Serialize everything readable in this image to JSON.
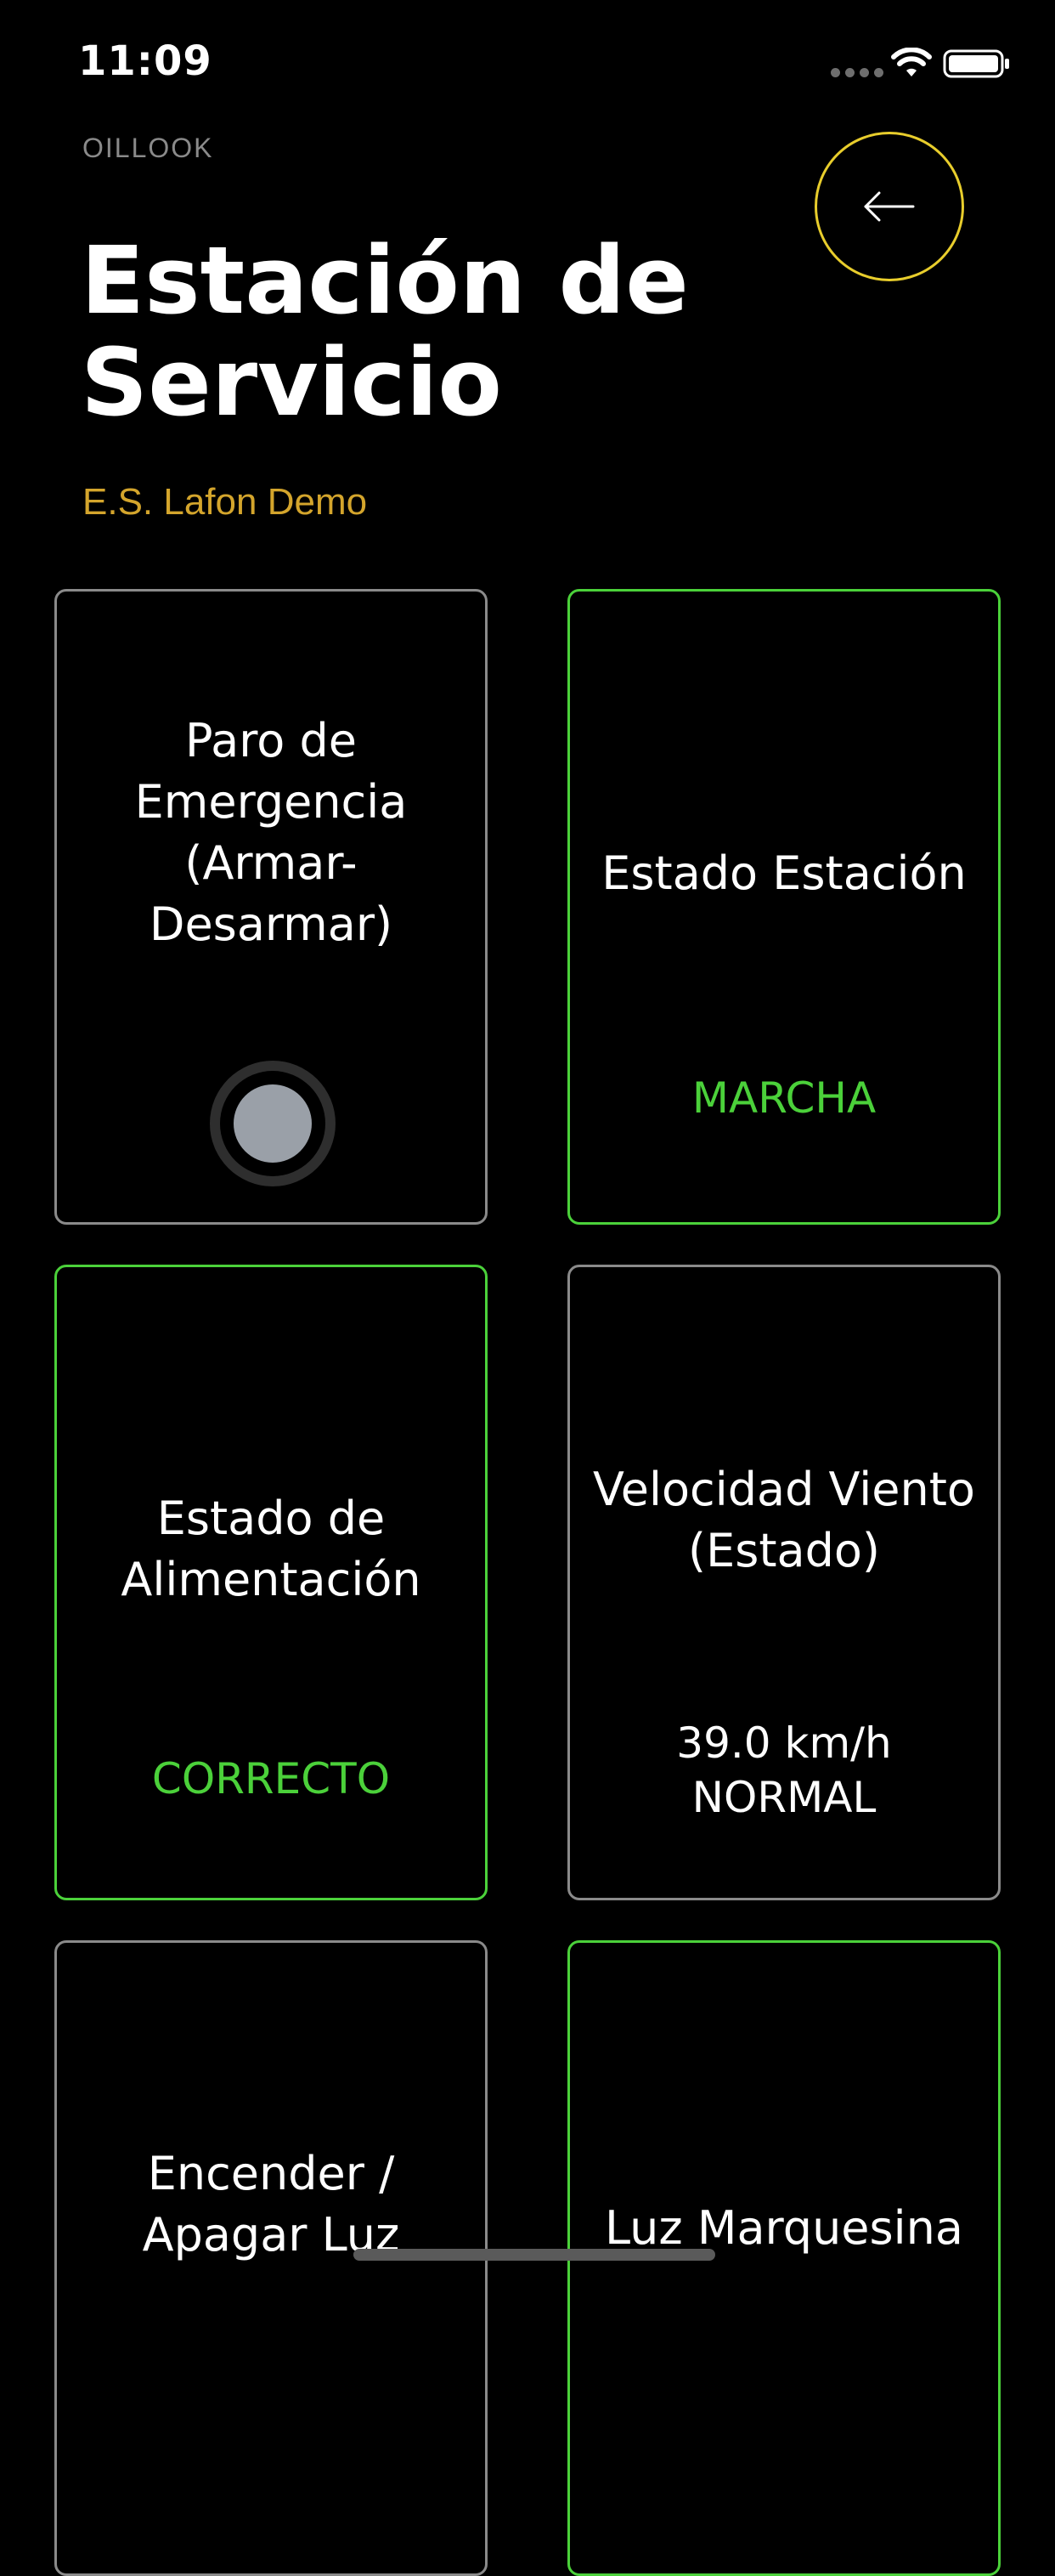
{
  "status_bar": {
    "time": "11:09"
  },
  "header": {
    "brand": "OILLOOK",
    "title": "Estación de Servicio",
    "subtitle": "E.S. Lafon Demo",
    "back_icon": "arrow-left-icon"
  },
  "cards": [
    {
      "title": "Paro de\nEmergencia\n(Armar-\nDesarmar)",
      "control": "toggle",
      "toggle_on": false,
      "status": "neutral"
    },
    {
      "title": "Estado Estación",
      "value": "MARCHA",
      "status": "ok"
    },
    {
      "title": "Estado de\nAlimentación",
      "value": "CORRECTO",
      "status": "ok"
    },
    {
      "title": "Velocidad Viento\n(Estado)",
      "value": "39.0 km/h\nNORMAL",
      "status": "neutral"
    },
    {
      "title": "Encender /\nApagar Luz",
      "status": "neutral"
    },
    {
      "title": "Luz Marquesina",
      "status": "ok"
    }
  ],
  "colors": {
    "background": "#000000",
    "accent_yellow": "#e8cd2c",
    "subtitle_gold": "#d4a52c",
    "ok_green": "#4bd13a",
    "neutral_border": "#8a8a8a"
  }
}
